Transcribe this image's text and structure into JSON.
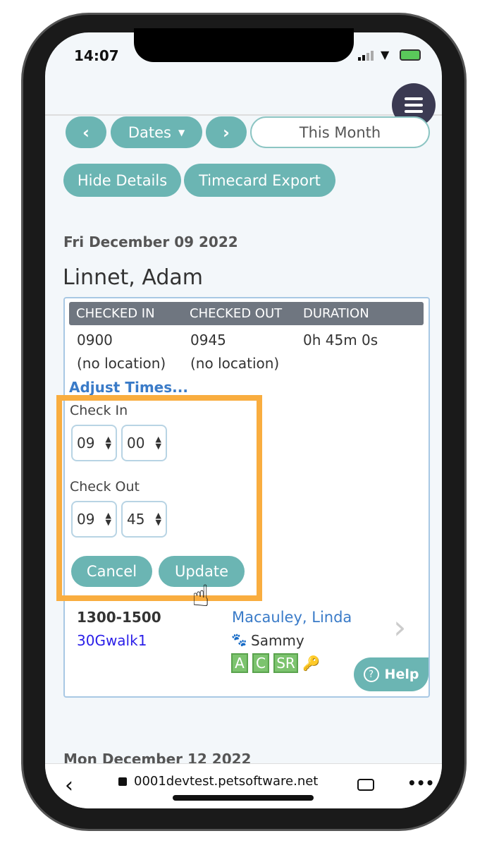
{
  "status_bar": {
    "time": "14:07"
  },
  "toolbar": {
    "prev_icon": "chevron-left",
    "dates_label": "Dates",
    "next_icon": "chevron-right",
    "range_value": "This Month",
    "hide_details": "Hide Details",
    "timecard_export": "Timecard Export",
    "menu_icon": "hamburger"
  },
  "day1": {
    "date": "Fri December 09 2022",
    "staff_name": "Linnet, Adam",
    "table": {
      "headers": [
        "CHECKED IN",
        "CHECKED OUT",
        "DURATION"
      ],
      "row": [
        "0900",
        "0945",
        "0h 45m 0s"
      ],
      "locations": [
        "(no location)",
        "(no location)"
      ]
    },
    "adjust_link": "Adjust Times...",
    "check_in_label": "Check In",
    "check_in_hour": "09",
    "check_in_min": "00",
    "check_out_label": "Check Out",
    "check_out_hour": "09",
    "check_out_min": "45",
    "cancel": "Cancel",
    "update": "Update",
    "appointment": {
      "time": "1300-1500",
      "service": "30Gwalk1",
      "client": "Macauley, Linda",
      "pet": "Sammy",
      "badges": [
        "A",
        "C",
        "SR"
      ]
    }
  },
  "help": "Help",
  "day2": {
    "date": "Mon December 12 2022"
  },
  "browser": {
    "url": "0001devtest.petsoftware.net"
  },
  "colors": {
    "accent": "#6bb5b3",
    "highlight": "#f9ad3f",
    "link": "#3a7bc8",
    "menu": "#3b3a52"
  }
}
